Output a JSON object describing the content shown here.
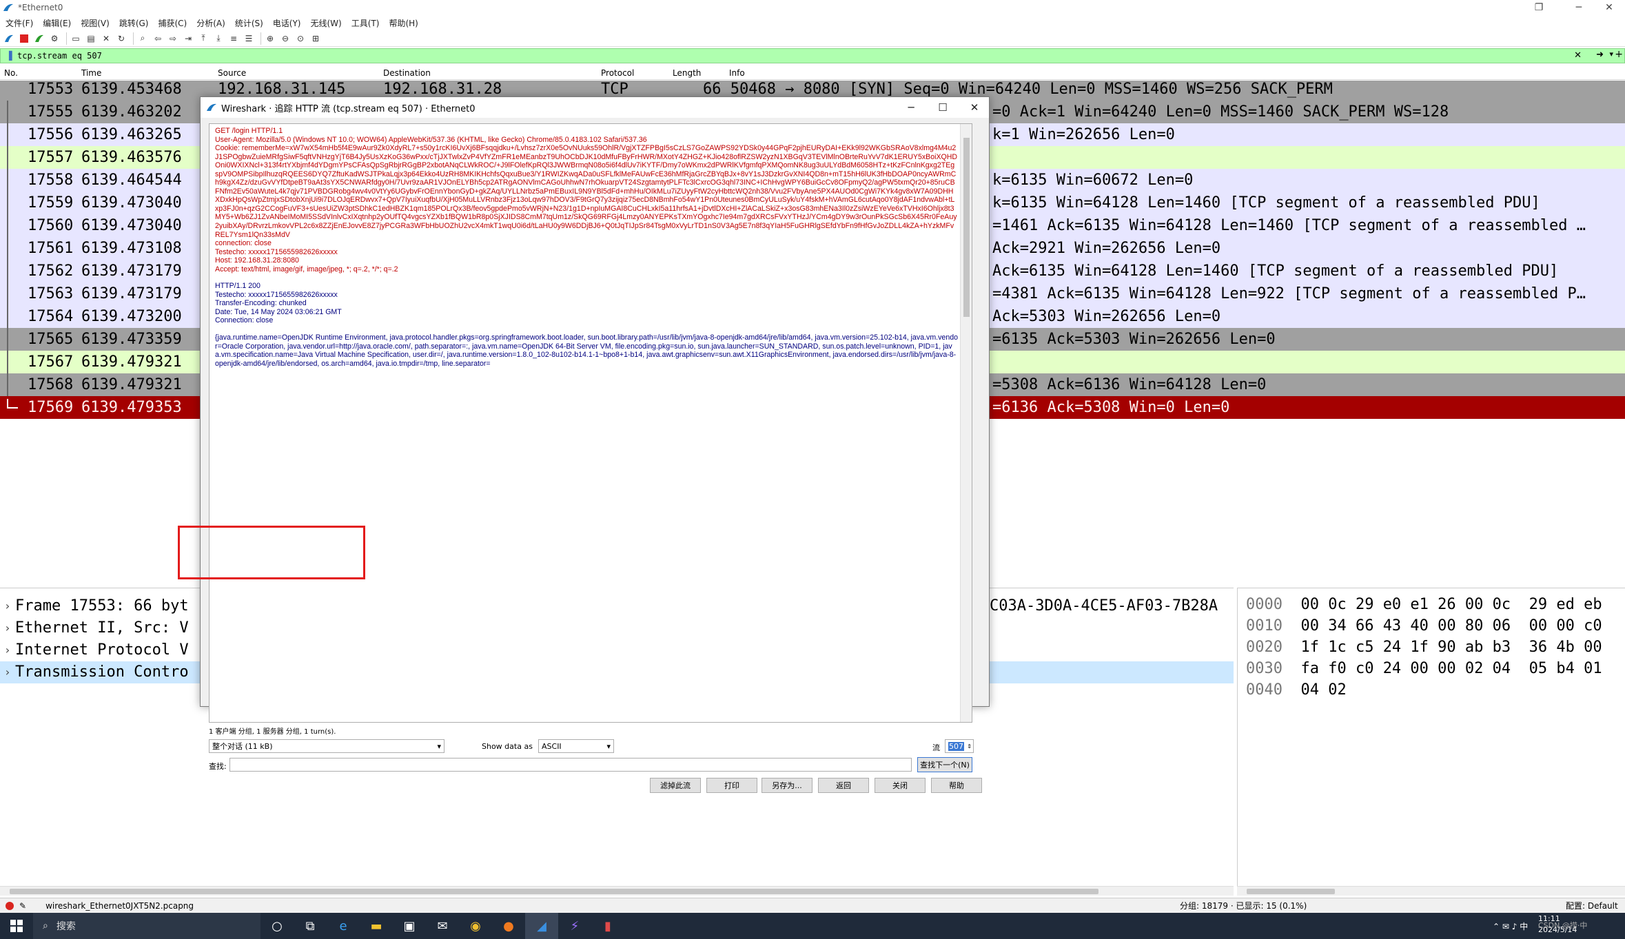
{
  "window": {
    "title": "*Ethernet0",
    "controls": [
      "─",
      "❐",
      "✕"
    ]
  },
  "menu": [
    "文件(F)",
    "编辑(E)",
    "视图(V)",
    "跳转(G)",
    "捕获(C)",
    "分析(A)",
    "统计(S)",
    "电话(Y)",
    "无线(W)",
    "工具(T)",
    "帮助(H)"
  ],
  "filter": {
    "value": "tcp.stream eq 507"
  },
  "columns": {
    "no": "No.",
    "time": "Time",
    "source": "Source",
    "destination": "Destination",
    "protocol": "Protocol",
    "length": "Length",
    "info": "Info"
  },
  "packets": [
    {
      "no": "17553",
      "time": "6139.453468",
      "src": "192.168.31.145",
      "dst": "192.168.31.28",
      "proto": "TCP",
      "info": "66 50468 → 8080 [SYN] Seq=0 Win=64240 Len=0 MSS=1460 WS=256 SACK_PERM",
      "bg": "#a0a0a0"
    },
    {
      "no": "17555",
      "time": "6139.463202",
      "src": "",
      "dst": "",
      "proto": "",
      "info": "=0 Ack=1 Win=64240 Len=0 MSS=1460 SACK_PERM WS=128",
      "bg": "#a0a0a0"
    },
    {
      "no": "17556",
      "time": "6139.463265",
      "src": "",
      "dst": "",
      "proto": "",
      "info": "k=1 Win=262656 Len=0",
      "bg": "#e7e6ff"
    },
    {
      "no": "17557",
      "time": "6139.463576",
      "src": "",
      "dst": "",
      "proto": "",
      "info": "",
      "bg": "#e4ffc7"
    },
    {
      "no": "17558",
      "time": "6139.464544",
      "src": "",
      "dst": "",
      "proto": "",
      "info": "k=6135 Win=60672 Len=0",
      "bg": "#e7e6ff"
    },
    {
      "no": "17559",
      "time": "6139.473040",
      "src": "",
      "dst": "",
      "proto": "",
      "info": "k=6135 Win=64128 Len=1460 [TCP segment of a reassembled PDU]",
      "bg": "#e7e6ff"
    },
    {
      "no": "17560",
      "time": "6139.473040",
      "src": "",
      "dst": "",
      "proto": "",
      "info": "=1461 Ack=6135 Win=64128 Len=1460 [TCP segment of a reassembled …",
      "bg": "#e7e6ff"
    },
    {
      "no": "17561",
      "time": "6139.473108",
      "src": "",
      "dst": "",
      "proto": "",
      "info": " Ack=2921 Win=262656 Len=0",
      "bg": "#e7e6ff"
    },
    {
      "no": "17562",
      "time": "6139.473179",
      "src": "",
      "dst": "",
      "proto": "",
      "info": " Ack=6135 Win=64128 Len=1460 [TCP segment of a reassembled PDU]",
      "bg": "#e7e6ff"
    },
    {
      "no": "17563",
      "time": "6139.473179",
      "src": "",
      "dst": "",
      "proto": "",
      "info": "=4381 Ack=6135 Win=64128 Len=922 [TCP segment of a reassembled P…",
      "bg": "#e7e6ff"
    },
    {
      "no": "17564",
      "time": "6139.473200",
      "src": "",
      "dst": "",
      "proto": "",
      "info": " Ack=5303 Win=262656 Len=0",
      "bg": "#e7e6ff"
    },
    {
      "no": "17565",
      "time": "6139.473359",
      "src": "",
      "dst": "",
      "proto": "",
      "info": "=6135 Ack=5303 Win=262656 Len=0",
      "bg": "#a0a0a0"
    },
    {
      "no": "17567",
      "time": "6139.479321",
      "src": "",
      "dst": "",
      "proto": "",
      "info": "",
      "bg": "#e4ffc7"
    },
    {
      "no": "17568",
      "time": "6139.479321",
      "src": "",
      "dst": "",
      "proto": "",
      "info": "=5308 Ack=6136 Win=64128 Len=0",
      "bg": "#a0a0a0"
    },
    {
      "no": "17569",
      "time": "6139.479353",
      "src": "",
      "dst": "",
      "proto": "",
      "info": "=6136 Ack=5308 Win=0 Len=0",
      "bg": "#a40000"
    }
  ],
  "details": [
    {
      "text": "Frame 17553: 66 byt",
      "tail": "C03A-3D0A-4CE5-AF03-7B28A",
      "selected": false
    },
    {
      "text": "Ethernet II, Src: V",
      "tail": "",
      "selected": false
    },
    {
      "text": "Internet Protocol V",
      "tail": "",
      "selected": false
    },
    {
      "text": "Transmission Contro",
      "tail": "",
      "selected": true
    }
  ],
  "hex": [
    {
      "off": "0000",
      "bytes": "00 0c 29 e0 e1 26 00 0c  29 ed eb"
    },
    {
      "off": "0010",
      "bytes": "00 34 66 43 40 00 80 06  00 00 c0"
    },
    {
      "off": "0020",
      "bytes": "1f 1c c5 24 1f 90 ab b3  36 4b 00"
    },
    {
      "off": "0030",
      "bytes": "fa f0 c0 24 00 00 02 04  05 b4 01"
    },
    {
      "off": "0040",
      "bytes": "04 02"
    }
  ],
  "status": {
    "file": "wireshark_Ethernet0JXT5N2.pcapng",
    "packets": "分组: 18179 · 已显示: 15 (0.1%)",
    "profile": "配置: Default"
  },
  "taskbar": {
    "search_placeholder": "搜索",
    "time": "11:11",
    "date": "2024/5/14",
    "watermark": "CSDN @捞·中"
  },
  "dialog": {
    "title": "Wireshark · 追踪 HTTP 流 (tcp.stream eq 507) · Ethernet0",
    "request_lines": [
      "GET /login HTTP/1.1",
      "User-Agent: Mozilla/5.0 (Windows NT 10.0; WOW64) AppleWebKit/537.36 (KHTML, like Gecko) Chrome/85.0.4183.102 Safari/537.36",
      "Cookie: rememberMe=xW7wX54mHb5f4E9wAur9Zk0XdyRL7+s50y1rcKI6UvXj6BFsqqjdku+/Lvhsz7zrX0e5OvNUuks59OhlR/VgjXTZFPBgI5sCzLS7GoZAWPS92YDSk0y44GPqF2pjhEURyDAI+EKk9l92WKGbSRAoV8xlmg4M4u2J1SPOgbwZuieMRfgSiwF5qftVNHzgYjT6B4Jy5UsXzKoG36wPxx/cTjJXTwlxZvP4VfYZmFR1eMEanbzT9UhOCbDJK10dMfuFByFrHWR/MXotY4ZHGZ+KJio428oflRZSW2yzN1XBGqV3TEVlMlnOBrteRuYvV7dK1ERUY5xBoiXQHDOni0WXIXNcl+313f4rtYXbjmf4dYDgmYPsCFAsQpSgRbjrRGgBP2xbotANqCLWkROC/+J9lFOlefKpRQl3JWWBrmqN08o5i6f4dlUv7iKYTF/Dmy7oWKmx2dPWRlKVfgmfqPXMQomNK8ug3uULYdBdM6058HTz+tKzFCnlnKgxg2TEgspV9OMPSibpIlhuzqRQEES6DYQ7ZftuKadWSJTPkaLqjx3p64Ekko4UzRH8MKIKHchfsQqxuBue3/Y1RWIZKwqADa0uSFLfklMeFAUwFcE36hMfRjaGrcZBYqBJx+8vY1sJ3DzkrGvXNI4QD8n+mT15hH6lUK3fHbDOAP0ncyAWRmCh9kgX4Zz/dzuGvVYfDtpeBT9aAt3sYX5CNWARfdgy0H/7Uvr9zaAR1VJOnELYBh5cp2ATRgAONVlmCAGoUhhwN7rhOkuarpVT24SzgtamtytPLFTc3lCxrcOG3qhl73INC+IChHvgWPY6BuiGcCv8OFpmyQ2/agPW5txmQr20+85ruCBFNfm2Ev50aWuteL4k7qjv71PVBDGRobg4wv4v0VtYy6UGybvFrOEnnYbonGyD+gkZAq/UYLLNrbz5aPmEBuxIL9N9YBl5dFd+mhHu/OIkMLu7iZUyyFtW2cyHbttcWQ2nh38/Vvu2FVbyAne5PX4AUOd0CgWi7KYk4gv8xW7A09DHHXDxkHpQsWpZtmjxSDtobXnjUi9i7DLOJqERDwvx7+QpV7IyuiXuqfbU/XjH05MuLLVRnbz3Fjz13oLqw97hDOV3/F9tGrQ7y3zijqiz75ecD8NBmhFo54wY1Pn0Uteunes0BmCyULuSyk/uY4fskM+hVAmGL6cutAqo0Y8jdAF1ndvwAbl+tLxp3FJ0n+qzG2CCogFuVF3+sUesUiZW3ptSDhkC1edHBZK1qm185POLrQx3B/feov5gpdePmo5vWRjN+N23/1g1D+npIuMGAI8CuCHLxkI5a11hrfsA1+jDvtlDXcHI+ZlACaLSkiZ+x3osG83mhENa3Il0zZsiWzEYeVe6xTVHxI6Ohljx8t3MY5+Wb6ZJ1ZvANbeIMoMI5SSdVInlvCxIXqtnhp2yOUfTQ4vgcsYZXb1fBQW1bR8p0SjXJIDS8CmM7tqUm1z/SkQG69RFGj4Lmzy0ANYEPKsTXmYOgxhc7Ie94m7gdXRCsFVxYTHzJ/YCm4gDY9w3rOunPkSGcSb6X45Rr0FeAuy2yuibXAy/DRvrzLmkovVPL2c6x8ZZjEnEJovvE8Z7jyPCGRa3WFbHbUOZhU2vcX4mkT1wqU0i6d/tLaHU0y9W6DDjBJ6+Q0tJqTIJpSr84TsgM0xVyLrTD1nS0V3Ag5E7n8f3qYIaH5FuGHRlgSEfdYbFn9fHfGvJoZDLL4kZA+hYzkMFvREL7Ysm1lQn33sMdV",
      "connection: close",
      "Testecho: xxxxx1715655982626xxxxx",
      "Host: 192.168.31.28:8080",
      "Accept: text/html, image/gif, image/jpeg, *; q=.2, */*; q=.2"
    ],
    "response_lines": [
      "HTTP/1.1 200",
      "Testecho: xxxxx1715655982626xxxxx",
      "Transfer-Encoding: chunked",
      "Date: Tue, 14 May 2024 03:06:21 GMT",
      "Connection: close"
    ],
    "response_body": "{java.runtime.name=OpenJDK Runtime Environment, java.protocol.handler.pkgs=org.springframework.boot.loader, sun.boot.library.path=/usr/lib/jvm/java-8-openjdk-amd64/jre/lib/amd64, java.vm.version=25.102-b14, java.vm.vendor=Oracle Corporation, java.vendor.url=http://java.oracle.com/, path.separator=:, java.vm.name=OpenJDK 64-Bit Server VM, file.encoding.pkg=sun.io, sun.java.launcher=SUN_STANDARD, sun.os.patch.level=unknown, PID=1, java.vm.specification.name=Java Virtual Machine Specification, user.dir=/, java.runtime.version=1.8.0_102-8u102-b14.1-1~bpo8+1-b14, java.awt.graphicsenv=sun.awt.X11GraphicsEnvironment, java.endorsed.dirs=/usr/lib/jvm/java-8-openjdk-amd64/jre/lib/endorsed, os.arch=amd64, java.io.tmpdir=/tmp, line.separator=",
    "info": "1 客户端 分组, 1 服务器 分组, 1 turn(s).",
    "conversation": "整个对话 (11 kB)",
    "show_as_label": "Show data as",
    "show_as": "ASCII",
    "stream_label": "流",
    "stream_no": "507",
    "find_label": "查找:",
    "find_next": "查找下一个(N)",
    "buttons": [
      "滤掉此流",
      "打印",
      "另存为...",
      "返回",
      "关闭",
      "帮助"
    ]
  }
}
